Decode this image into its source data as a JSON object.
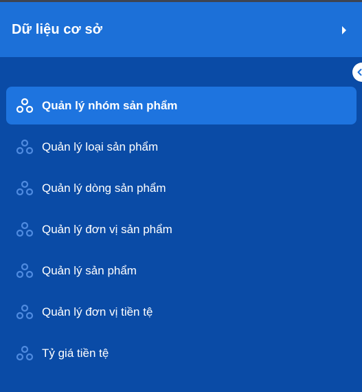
{
  "header": {
    "title": "Dữ liệu cơ sở",
    "expand_icon": "caret-right-icon"
  },
  "sidebar_toggle": {
    "icon": "chevron-left-icon"
  },
  "menu": {
    "items": [
      {
        "label": "Quản lý nhóm sản phẩm",
        "icon": "cluster-icon",
        "active": true
      },
      {
        "label": "Quản lý loại sản phẩm",
        "icon": "cluster-icon",
        "active": false
      },
      {
        "label": "Quản lý dòng sản phẩm",
        "icon": "cluster-icon",
        "active": false
      },
      {
        "label": "Quản lý đơn vị sản phẩm",
        "icon": "cluster-icon",
        "active": false
      },
      {
        "label": "Quản lý sản phẩm",
        "icon": "cluster-icon",
        "active": false
      },
      {
        "label": "Quản lý đơn vị tiền tệ",
        "icon": "cluster-icon",
        "active": false
      },
      {
        "label": "Tỷ giá tiền tệ",
        "icon": "cluster-icon",
        "active": false
      }
    ]
  },
  "colors": {
    "sidebar_bg": "#0a4ba6",
    "header_bg": "#1c70d8",
    "active_item_bg": "#1e74df",
    "active_icon": "#ffffff",
    "inactive_icon": "#4f8be0",
    "text": "#ffffff"
  }
}
